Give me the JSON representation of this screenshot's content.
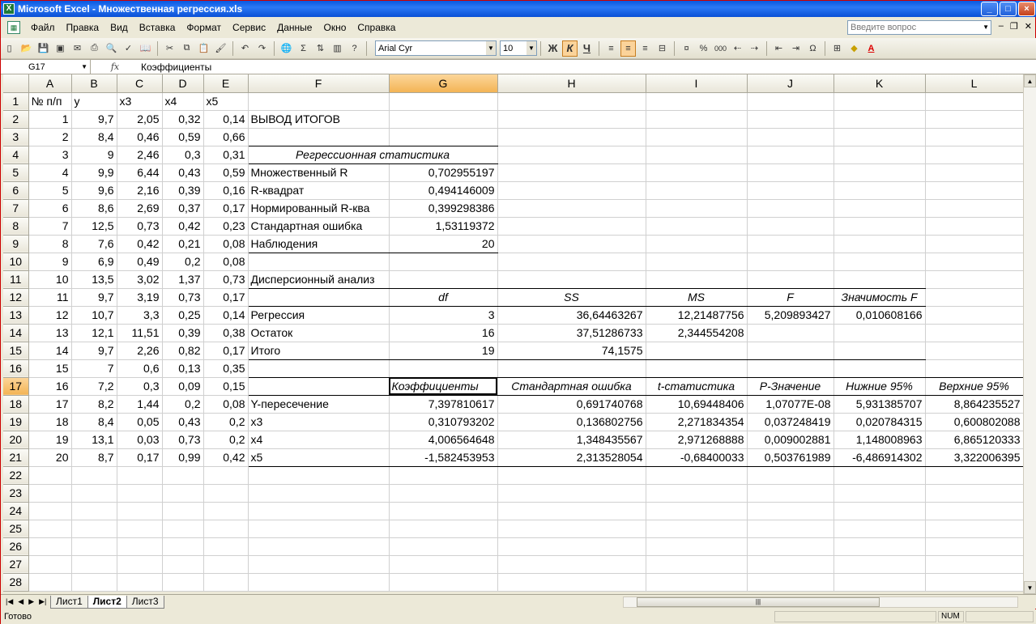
{
  "window": {
    "title": "Microsoft Excel - Множественная регрессия.xls",
    "min": "_",
    "max": "□",
    "close": "×"
  },
  "menu": {
    "items": [
      "Файл",
      "Правка",
      "Вид",
      "Вставка",
      "Формат",
      "Сервис",
      "Данные",
      "Окно",
      "Справка"
    ],
    "help_placeholder": "Введите вопрос"
  },
  "toolbar": {
    "font": "Arial Cyr",
    "size": "10",
    "bold": "Ж",
    "italic": "К",
    "underline": "Ч",
    "sigma": "Σ",
    "percent": "%",
    "thousands": "000",
    "omega": "Ω"
  },
  "formula_bar": {
    "cell": "G17",
    "fx": "fx",
    "content": "Коэффициенты"
  },
  "columns": [
    "A",
    "B",
    "C",
    "D",
    "E",
    "F",
    "G",
    "H",
    "I",
    "J",
    "K",
    "L"
  ],
  "rows": [
    [
      "№ п/п",
      "y",
      "x3",
      "x4",
      "x5",
      "",
      "",
      "",
      "",
      "",
      "",
      ""
    ],
    [
      "1",
      "9,7",
      "2,05",
      "0,32",
      "0,14",
      "ВЫВОД ИТОГОВ",
      "",
      "",
      "",
      "",
      "",
      ""
    ],
    [
      "2",
      "8,4",
      "0,46",
      "0,59",
      "0,66",
      "",
      "",
      "",
      "",
      "",
      "",
      ""
    ],
    [
      "3",
      "9",
      "2,46",
      "0,3",
      "0,31",
      "Регрессионная статистика",
      "",
      "",
      "",
      "",
      "",
      ""
    ],
    [
      "4",
      "9,9",
      "6,44",
      "0,43",
      "0,59",
      "Множественный R",
      "0,702955197",
      "",
      "",
      "",
      "",
      ""
    ],
    [
      "5",
      "9,6",
      "2,16",
      "0,39",
      "0,16",
      "R-квадрат",
      "0,494146009",
      "",
      "",
      "",
      "",
      ""
    ],
    [
      "6",
      "8,6",
      "2,69",
      "0,37",
      "0,17",
      "Нормированный R-ква",
      "0,399298386",
      "",
      "",
      "",
      "",
      ""
    ],
    [
      "7",
      "12,5",
      "0,73",
      "0,42",
      "0,23",
      "Стандартная ошибка",
      "1,53119372",
      "",
      "",
      "",
      "",
      ""
    ],
    [
      "8",
      "7,6",
      "0,42",
      "0,21",
      "0,08",
      "Наблюдения",
      "20",
      "",
      "",
      "",
      "",
      ""
    ],
    [
      "9",
      "6,9",
      "0,49",
      "0,2",
      "0,08",
      "",
      "",
      "",
      "",
      "",
      "",
      ""
    ],
    [
      "10",
      "13,5",
      "3,02",
      "1,37",
      "0,73",
      "Дисперсионный анализ",
      "",
      "",
      "",
      "",
      "",
      ""
    ],
    [
      "11",
      "9,7",
      "3,19",
      "0,73",
      "0,17",
      "",
      "df",
      "SS",
      "MS",
      "F",
      "Значимость F",
      ""
    ],
    [
      "12",
      "10,7",
      "3,3",
      "0,25",
      "0,14",
      "Регрессия",
      "3",
      "36,64463267",
      "12,21487756",
      "5,209893427",
      "0,010608166",
      ""
    ],
    [
      "13",
      "12,1",
      "11,51",
      "0,39",
      "0,38",
      "Остаток",
      "16",
      "37,51286733",
      "2,344554208",
      "",
      "",
      ""
    ],
    [
      "14",
      "9,7",
      "2,26",
      "0,82",
      "0,17",
      "Итого",
      "19",
      "74,1575",
      "",
      "",
      "",
      ""
    ],
    [
      "15",
      "7",
      "0,6",
      "0,13",
      "0,35",
      "",
      "",
      "",
      "",
      "",
      "",
      ""
    ],
    [
      "16",
      "7,2",
      "0,3",
      "0,09",
      "0,15",
      "",
      "Коэффициенты",
      "Стандартная ошибка",
      "t-статистика",
      "P-Значение",
      "Нижние 95%",
      "Верхние 95%"
    ],
    [
      "17",
      "8,2",
      "1,44",
      "0,2",
      "0,08",
      "Y-пересечение",
      "7,397810617",
      "0,691740768",
      "10,69448406",
      "1,07077E-08",
      "5,931385707",
      "8,864235527"
    ],
    [
      "18",
      "8,4",
      "0,05",
      "0,43",
      "0,2",
      "x3",
      "0,310793202",
      "0,136802756",
      "2,271834354",
      "0,037248419",
      "0,020784315",
      "0,600802088"
    ],
    [
      "19",
      "13,1",
      "0,03",
      "0,73",
      "0,2",
      "x4",
      "4,006564648",
      "1,348435567",
      "2,971268888",
      "0,009002881",
      "1,148008963",
      "6,865120333"
    ],
    [
      "20",
      "8,7",
      "0,17",
      "0,99",
      "0,42",
      "x5",
      "-1,582453953",
      "2,313528054",
      "-0,68400033",
      "0,503761989",
      "-6,486914302",
      "3,322006395"
    ],
    [
      "",
      "",
      "",
      "",
      "",
      "",
      "",
      "",
      "",
      "",
      "",
      ""
    ],
    [
      "",
      "",
      "",
      "",
      "",
      "",
      "",
      "",
      "",
      "",
      "",
      ""
    ],
    [
      "",
      "",
      "",
      "",
      "",
      "",
      "",
      "",
      "",
      "",
      "",
      ""
    ],
    [
      "",
      "",
      "",
      "",
      "",
      "",
      "",
      "",
      "",
      "",
      "",
      ""
    ],
    [
      "",
      "",
      "",
      "",
      "",
      "",
      "",
      "",
      "",
      "",
      "",
      ""
    ],
    [
      "",
      "",
      "",
      "",
      "",
      "",
      "",
      "",
      "",
      "",
      "",
      ""
    ],
    [
      "",
      "",
      "",
      "",
      "",
      "",
      "",
      "",
      "",
      "",
      "",
      ""
    ]
  ],
  "sheet_tabs": [
    "Лист1",
    "Лист2",
    "Лист3"
  ],
  "active_tab": "Лист2",
  "status": {
    "left": "Готово",
    "num": "NUM"
  }
}
